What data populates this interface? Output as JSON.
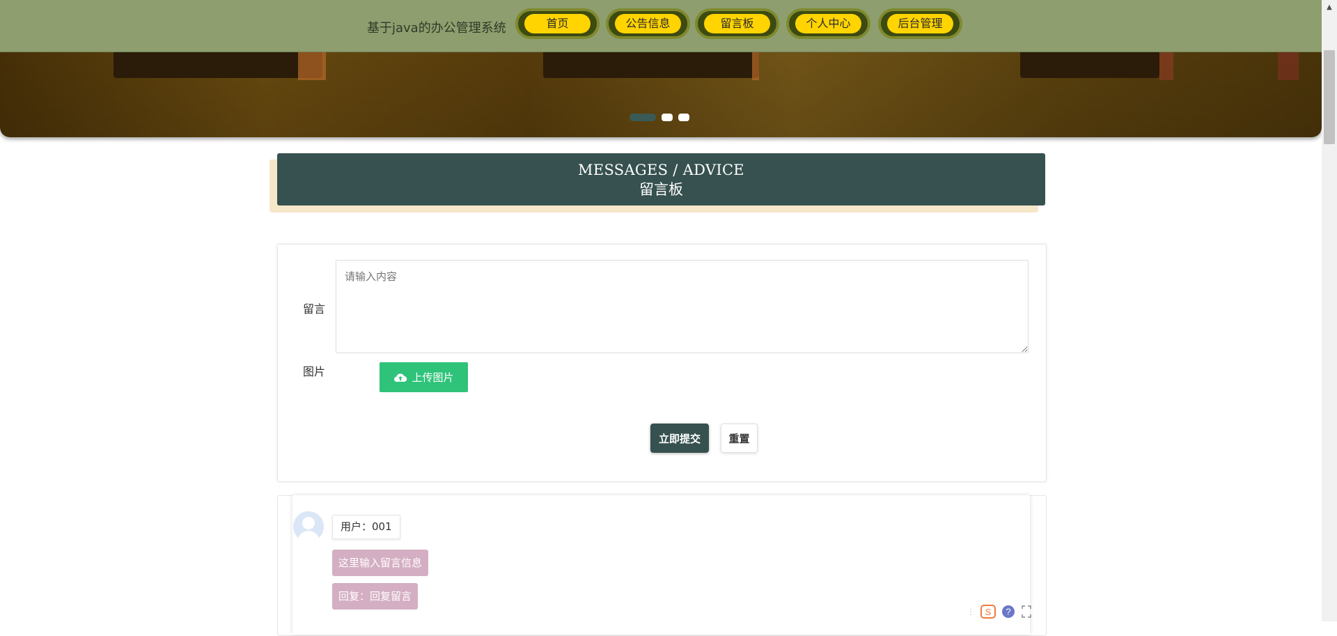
{
  "nav": {
    "site_title": "基于java的办公管理系统",
    "items": [
      {
        "label": "首页"
      },
      {
        "label": "公告信息"
      },
      {
        "label": "留言板"
      },
      {
        "label": "个人中心"
      },
      {
        "label": "后台管理"
      }
    ]
  },
  "banner": {
    "slides": 3,
    "active_slide": 1
  },
  "section": {
    "title_en": "MESSAGES / ADVICE",
    "title_cn": "留言板"
  },
  "form": {
    "message_label": "留言",
    "message_placeholder": "请输入内容",
    "image_label": "图片",
    "upload_label": "上传图片",
    "submit_label": "立即提交",
    "reset_label": "重置"
  },
  "messages": [
    {
      "user": "用户：001",
      "content": "这里输入留言信息",
      "reply": "回复：回复留言"
    }
  ],
  "colors": {
    "nav_bg": "#8e9e6e",
    "nav_pill": "#ffd400",
    "accent": "#36514f",
    "upload": "#2fc37a",
    "bubble": "#d4aec2"
  },
  "icons": [
    "cloud-upload-icon",
    "avatar-icon",
    "sogou-icon",
    "help-icon",
    "expand-icon"
  ]
}
